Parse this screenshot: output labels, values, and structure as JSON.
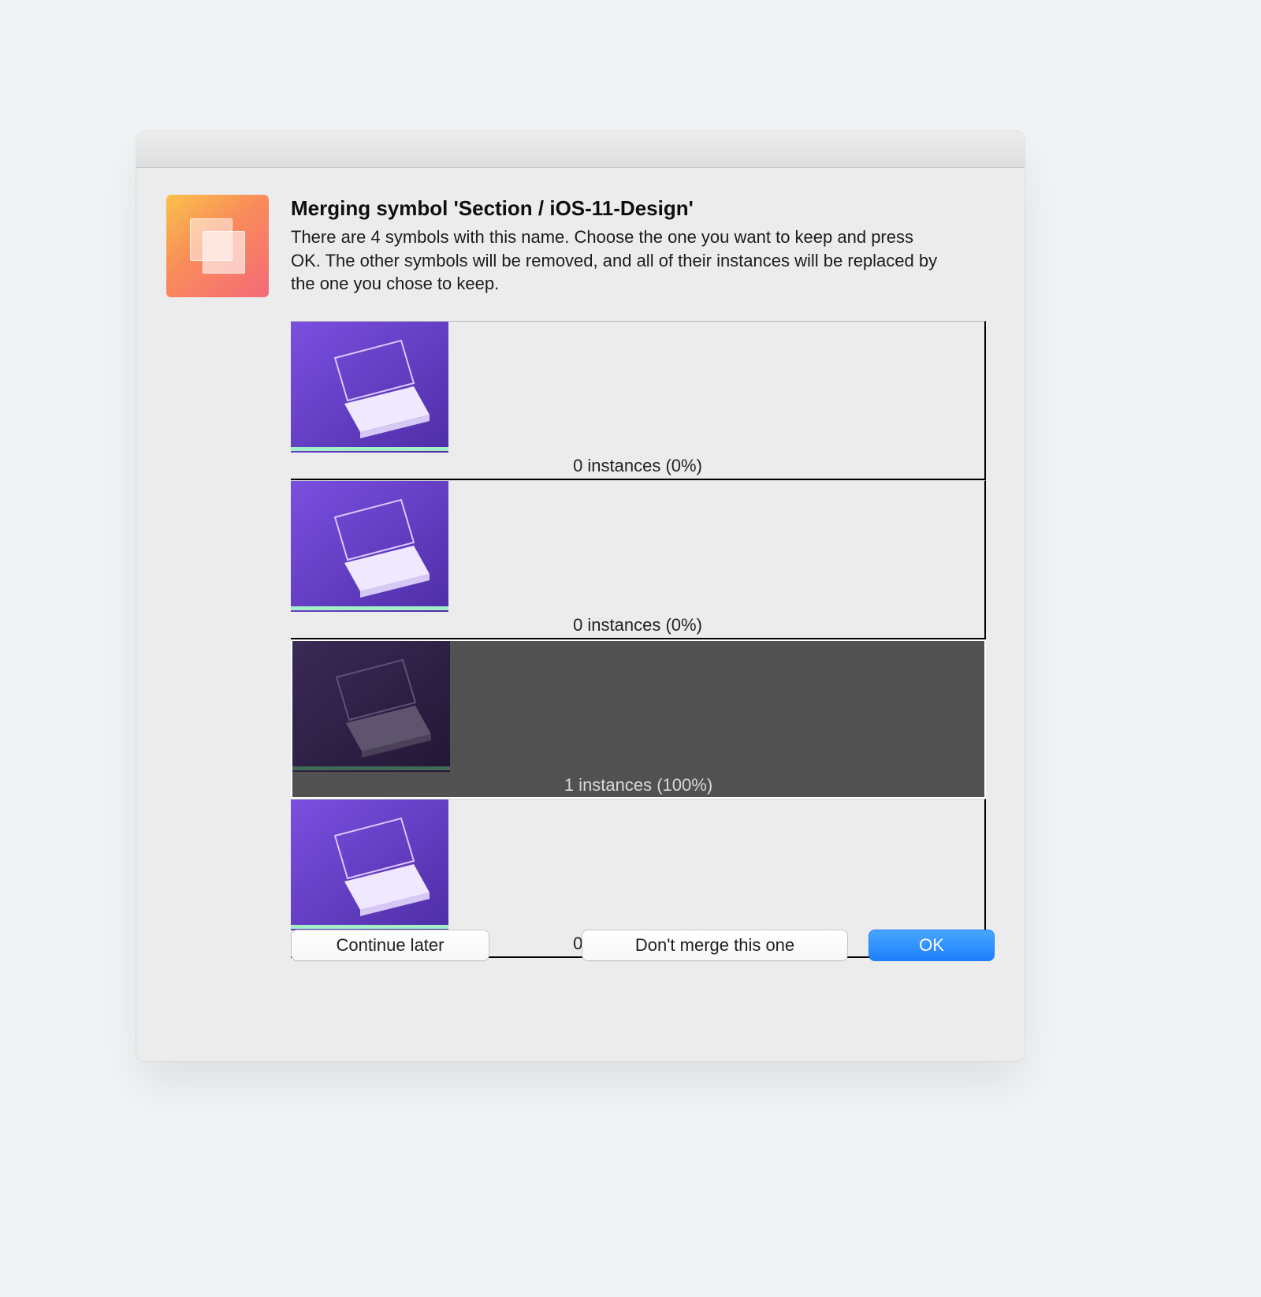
{
  "dialog": {
    "title": "Merging symbol 'Section / iOS-11-Design'",
    "description": "There are 4 symbols with this name. Choose the one you want to keep and press OK. The other symbols will be removed, and all of their instances will be replaced by the one you chose to keep."
  },
  "options": [
    {
      "label": "0 instances (0%)",
      "selected": false,
      "thumb": "laptop-purple"
    },
    {
      "label": "0 instances (0%)",
      "selected": false,
      "thumb": "laptop-purple"
    },
    {
      "label": "1 instances (100%)",
      "selected": true,
      "thumb": "laptop-dark"
    },
    {
      "label": "0 instances (0%)",
      "selected": false,
      "thumb": "laptop-purple"
    }
  ],
  "buttons": {
    "continue_later": "Continue later",
    "dont_merge": "Don't merge this one",
    "ok": "OK"
  },
  "colors": {
    "accent": "#1e7ffd",
    "thumb_bg": "#6a3fd1",
    "thumb_bg_dark": "#2d1f3a"
  }
}
